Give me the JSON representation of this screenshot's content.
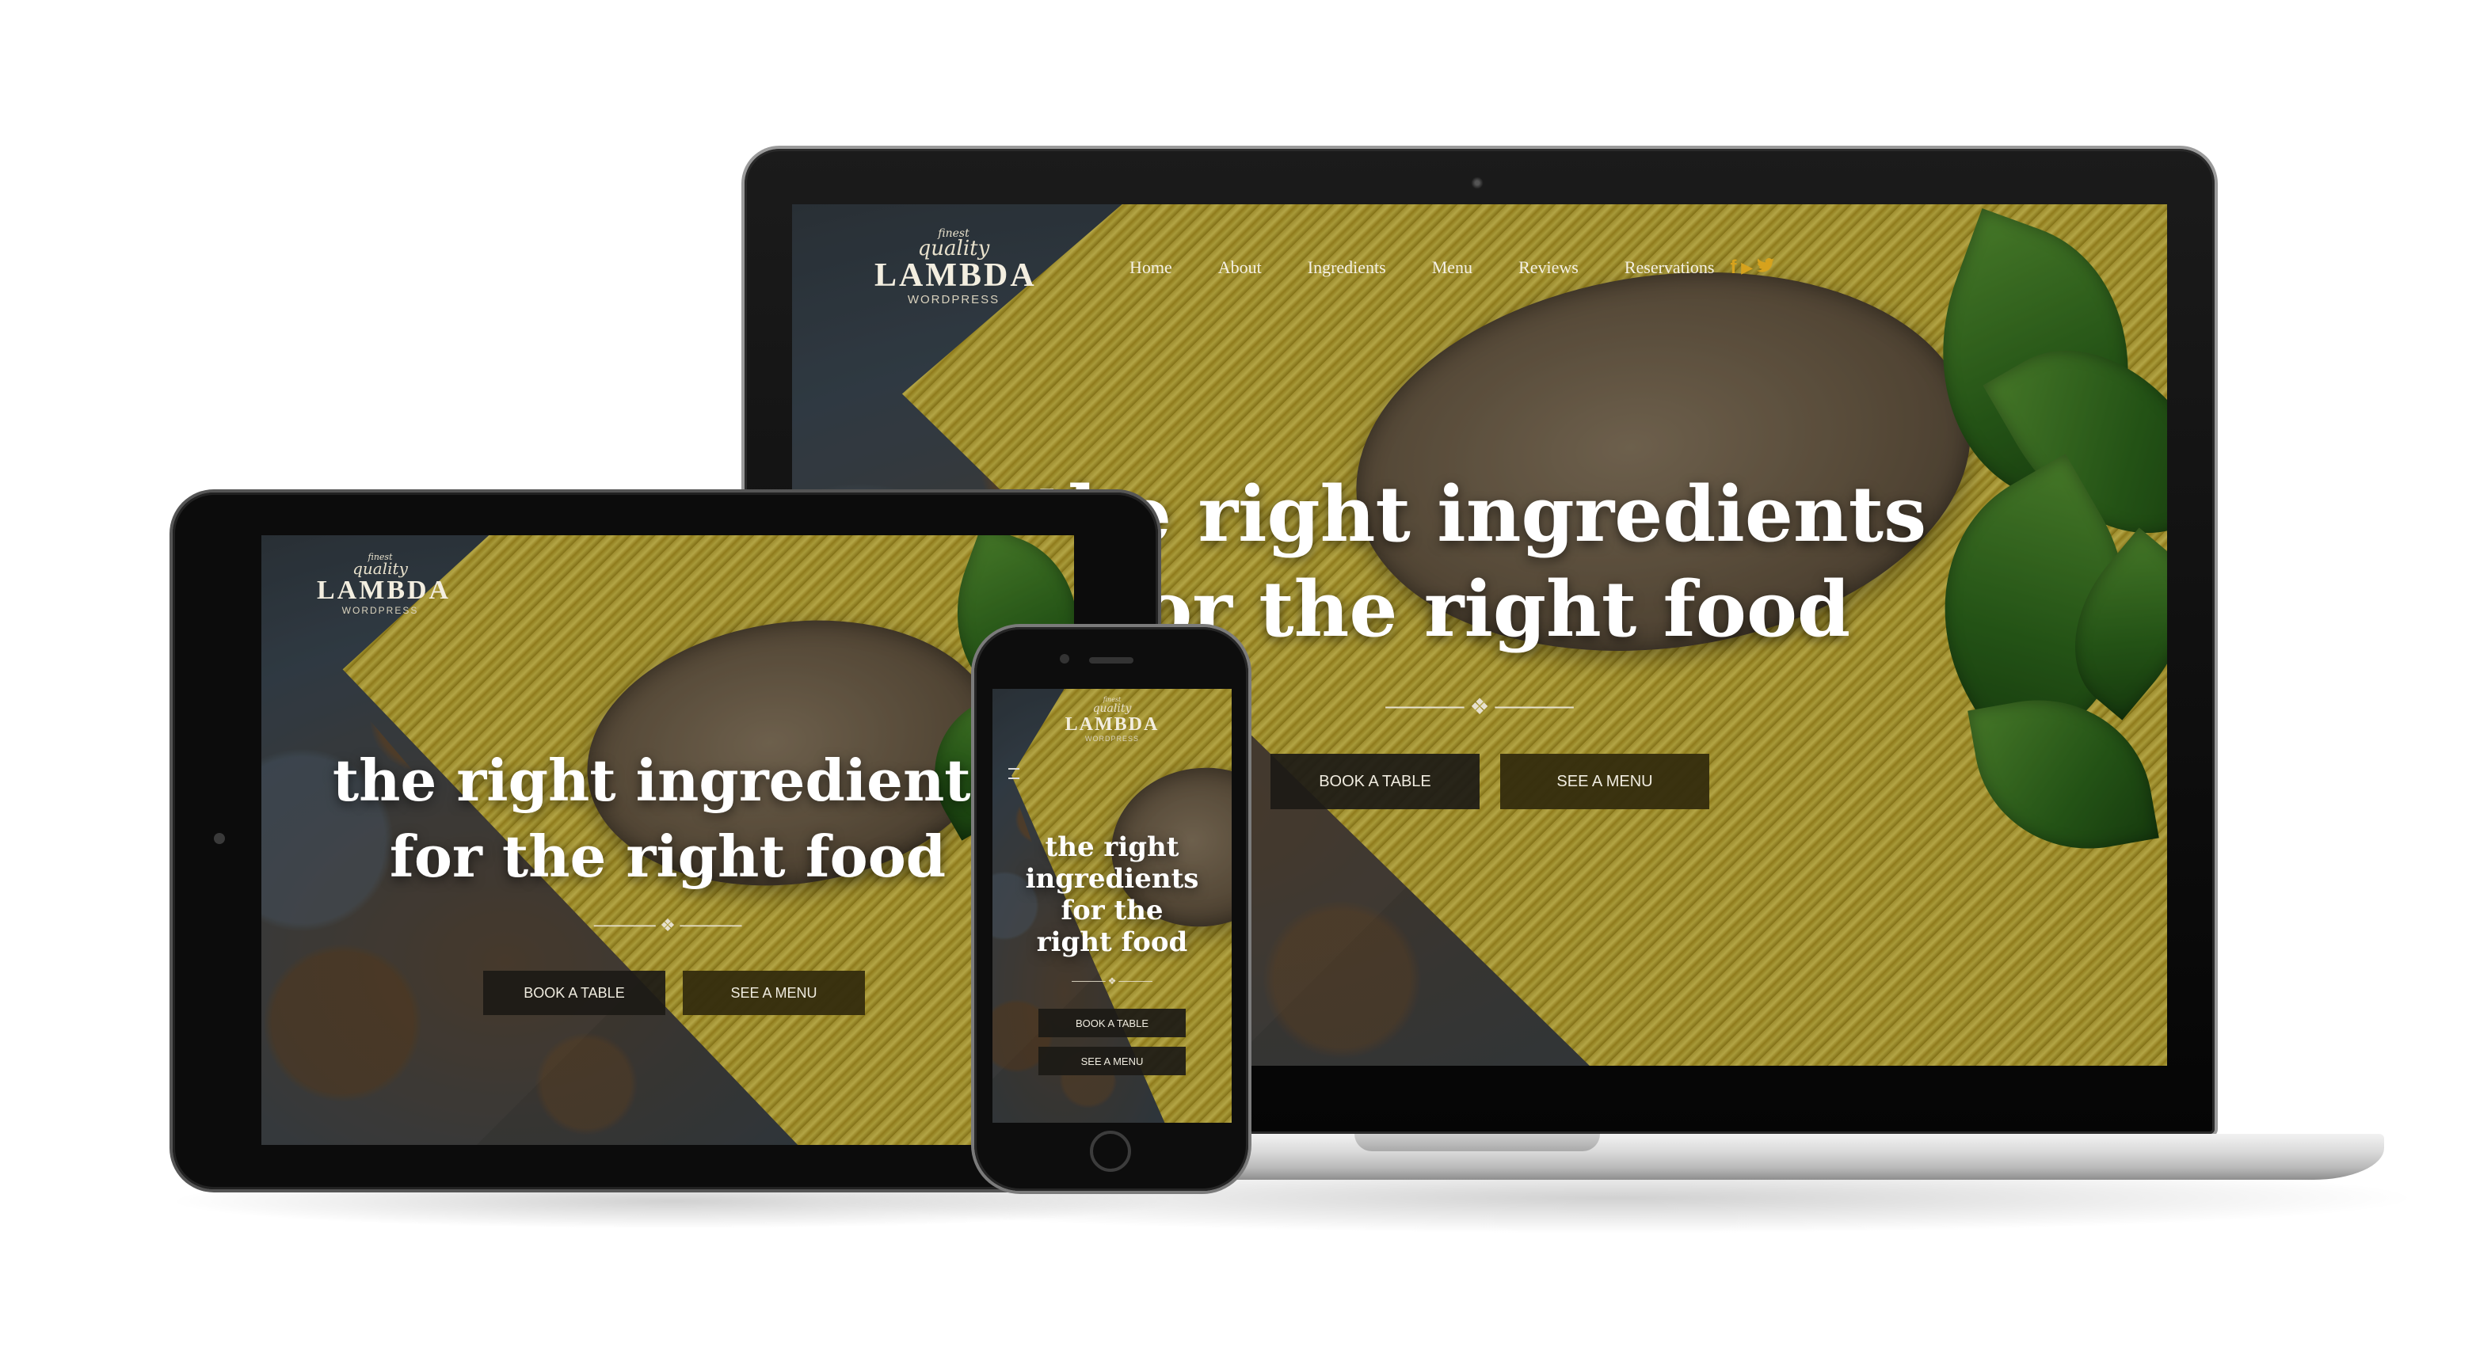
{
  "brand": {
    "finest": "finest",
    "quality": "quality",
    "name": "LAMBDA",
    "sub": "WORDPRESS"
  },
  "nav": {
    "items": [
      {
        "label": "Home"
      },
      {
        "label": "About"
      },
      {
        "label": "Ingredients"
      },
      {
        "label": "Menu"
      },
      {
        "label": "Reviews"
      },
      {
        "label": "Reservations"
      }
    ],
    "social": [
      "facebook-icon",
      "youtube-icon",
      "twitter-icon"
    ],
    "social_glyphs": {
      "facebook": "f",
      "youtube": "▶",
      "twitter": "🐦"
    }
  },
  "hero": {
    "line1": "the right ingredients",
    "line2": "for the right food",
    "phone_lines": [
      "the right",
      "ingredients",
      "for the",
      "right food"
    ],
    "ornament": "───── ❖ ─────",
    "book_label": "BOOK A TABLE",
    "menu_label": "SEE A MENU"
  },
  "colors": {
    "accent": "#d6a21d",
    "button_dark": "#1c1a16",
    "button_olive": "#342c0e"
  }
}
